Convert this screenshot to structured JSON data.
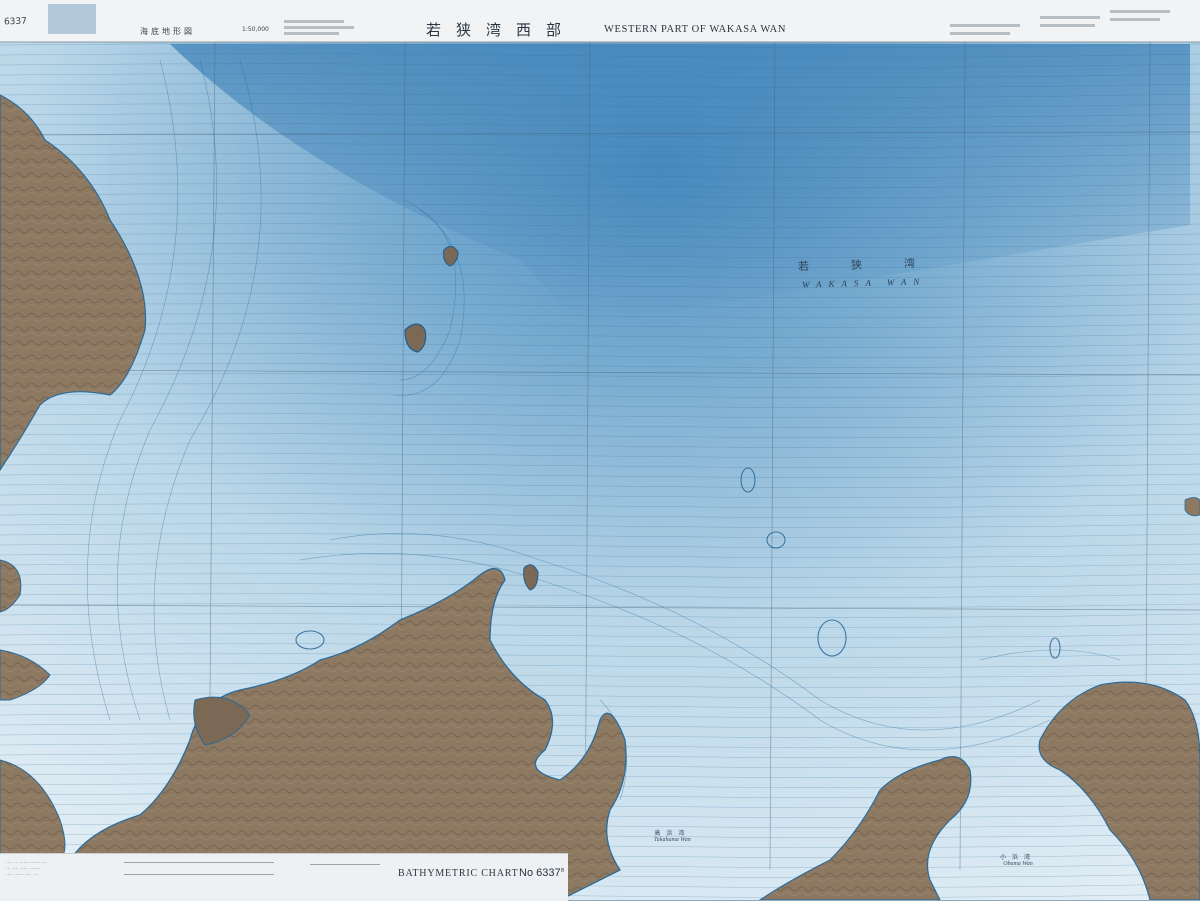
{
  "header": {
    "title_jp": "若狭湾西部",
    "title_en": "WESTERN PART OF WAKASA WAN",
    "series_jp": "海底地形図",
    "scale": "1:50,000",
    "chart_no": "6337"
  },
  "labels": {
    "sea_jp": "若狭湾",
    "sea_en": "WAKASA WAN",
    "bay_jp": "高浜湾",
    "bay_en": "Takahama Wan",
    "bay2_jp": "小浜湾",
    "bay2_en": "Obama Wan"
  },
  "footer": {
    "chart_type": "BATHYMETRIC CHART",
    "chart_no": "No 6337",
    "chart_no_suffix": "a"
  },
  "colors": {
    "sea_deep": "#5d97c2",
    "sea_shallow": "#d6e7f1",
    "land": "#8d7862",
    "land_dark": "#6d5a48",
    "contour": "#2a6b9a",
    "grid": "#4b6577",
    "panel": "#eef1f3"
  }
}
